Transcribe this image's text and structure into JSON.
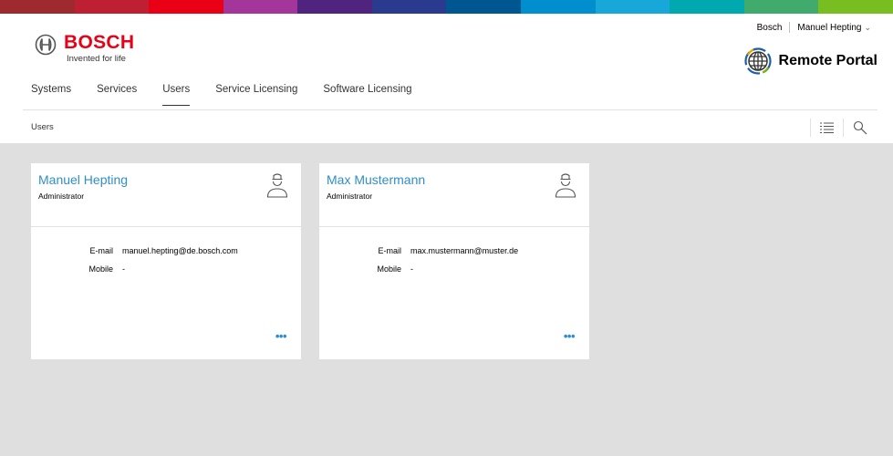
{
  "supergraphic_colors": [
    "#9e2a2f",
    "#be1f33",
    "#ea0016",
    "#a4359a",
    "#50237f",
    "#2a3b8f",
    "#005691",
    "#008ecf",
    "#18a7d9",
    "#00a8b0",
    "#40ab6c",
    "#78be20"
  ],
  "header": {
    "brand": "BOSCH",
    "tagline": "Invented for life",
    "brand_color": "#ea0016",
    "company_link": "Bosch",
    "user_menu": "Manuel Hepting",
    "user_menu_icon": "chevron-down-icon",
    "portal_title": "Remote Portal",
    "portal_icon": "globe-icon"
  },
  "nav": {
    "items": [
      {
        "label": "Systems",
        "active": false
      },
      {
        "label": "Services",
        "active": false
      },
      {
        "label": "Users",
        "active": true
      },
      {
        "label": "Service Licensing",
        "active": false
      },
      {
        "label": "Software Licensing",
        "active": false
      }
    ]
  },
  "breadcrumb": {
    "current": "Users"
  },
  "toolbar": {
    "list_icon": "list-view-icon",
    "search_icon": "search-icon"
  },
  "users": [
    {
      "name": "Manuel Hepting",
      "role": "Administrator",
      "email_label": "E-mail",
      "email": "manuel.hepting@de.bosch.com",
      "mobile_label": "Mobile",
      "mobile": "-",
      "more": "•••",
      "avatar_icon": "user-icon"
    },
    {
      "name": "Max Mustermann",
      "role": "Administrator",
      "email_label": "E-mail",
      "email": "max.mustermann@muster.de",
      "mobile_label": "Mobile",
      "mobile": "-",
      "more": "•••",
      "avatar_icon": "user-icon"
    }
  ],
  "colors": {
    "accent": "#2f8ecb",
    "background": "#dfdfdf"
  }
}
